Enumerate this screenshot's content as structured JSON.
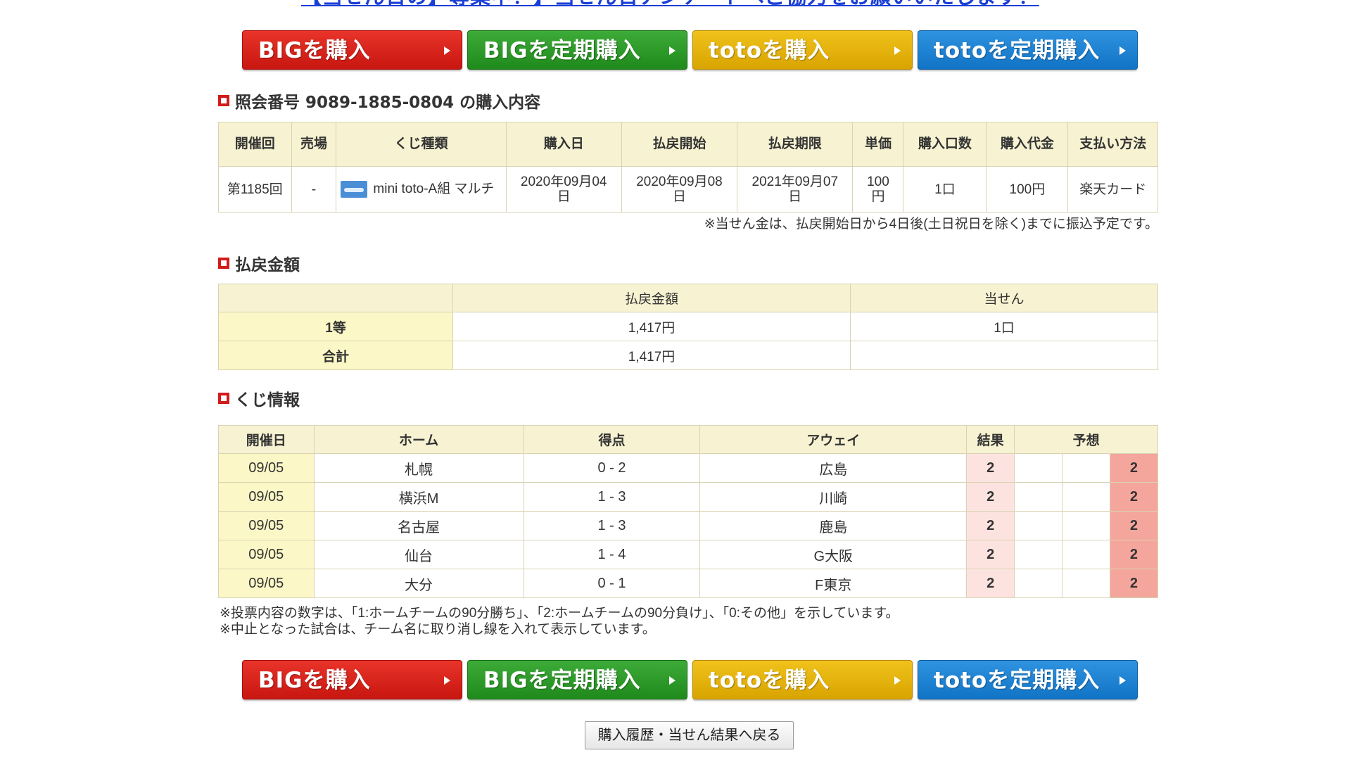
{
  "top_link": "【当せん日の】導集中！】当せん日アンケートへご協力をお願いいたします！",
  "buttons": [
    {
      "label": "BIGを購入",
      "color": "#d21f17"
    },
    {
      "label": "BIGを定期購入",
      "color": "#2a9a26"
    },
    {
      "label": "totoを購入",
      "color": "#e6b30a"
    },
    {
      "label": "totoを定期購入",
      "color": "#1f84d3"
    }
  ],
  "purchase": {
    "heading": "照会番号 9089-1885-0804 の購入内容",
    "headers": [
      "開催回",
      "売場",
      "くじ種類",
      "購入日",
      "払戻開始",
      "払戻期限",
      "単価",
      "購入口数",
      "購入代金",
      "支払い方法"
    ],
    "row": {
      "round": "第1185回",
      "store": "-",
      "kind": "mini toto-A組 マルチ",
      "purchase_date": "2020年09月04日",
      "payout_start": "2020年09月08日",
      "payout_deadline": "2021年09月07日",
      "unit_price": "100円",
      "count": "1口",
      "amount": "100円",
      "payment": "楽天カード"
    },
    "note": "※当せん金は、払戻開始日から4日後(土日祝日を除く)までに振込予定です。"
  },
  "payout": {
    "heading": "払戻金額",
    "headers": [
      "",
      "払戻金額",
      "当せん"
    ],
    "rows": [
      {
        "label": "1等",
        "amount": "1,417円",
        "count": "1口"
      },
      {
        "label": "合計",
        "amount": "1,417円",
        "count": ""
      }
    ]
  },
  "lottery": {
    "heading": "くじ情報",
    "headers": [
      "開催日",
      "ホーム",
      "得点",
      "アウェイ",
      "結果",
      "予想"
    ],
    "rows": [
      {
        "date": "09/05",
        "home": "札幌",
        "score": "0 - 2",
        "away": "広島",
        "result": "2",
        "p1": "",
        "p0": "",
        "p2": "2"
      },
      {
        "date": "09/05",
        "home": "横浜M",
        "score": "1 - 3",
        "away": "川崎",
        "result": "2",
        "p1": "",
        "p0": "",
        "p2": "2"
      },
      {
        "date": "09/05",
        "home": "名古屋",
        "score": "1 - 3",
        "away": "鹿島",
        "result": "2",
        "p1": "",
        "p0": "",
        "p2": "2"
      },
      {
        "date": "09/05",
        "home": "仙台",
        "score": "1 - 4",
        "away": "G大阪",
        "result": "2",
        "p1": "",
        "p0": "",
        "p2": "2"
      },
      {
        "date": "09/05",
        "home": "大分",
        "score": "0 - 1",
        "away": "F東京",
        "result": "2",
        "p1": "",
        "p0": "",
        "p2": "2"
      }
    ],
    "notes": [
      "※投票内容の数字は、「1:ホームチームの90分勝ち」、「2:ホームチームの90分負け」、「0:その他」を示しています。",
      "※中止となった試合は、チーム名に取り消し線を入れて表示しています。"
    ]
  },
  "back_button": "購入履歴・当せん結果へ戻る"
}
